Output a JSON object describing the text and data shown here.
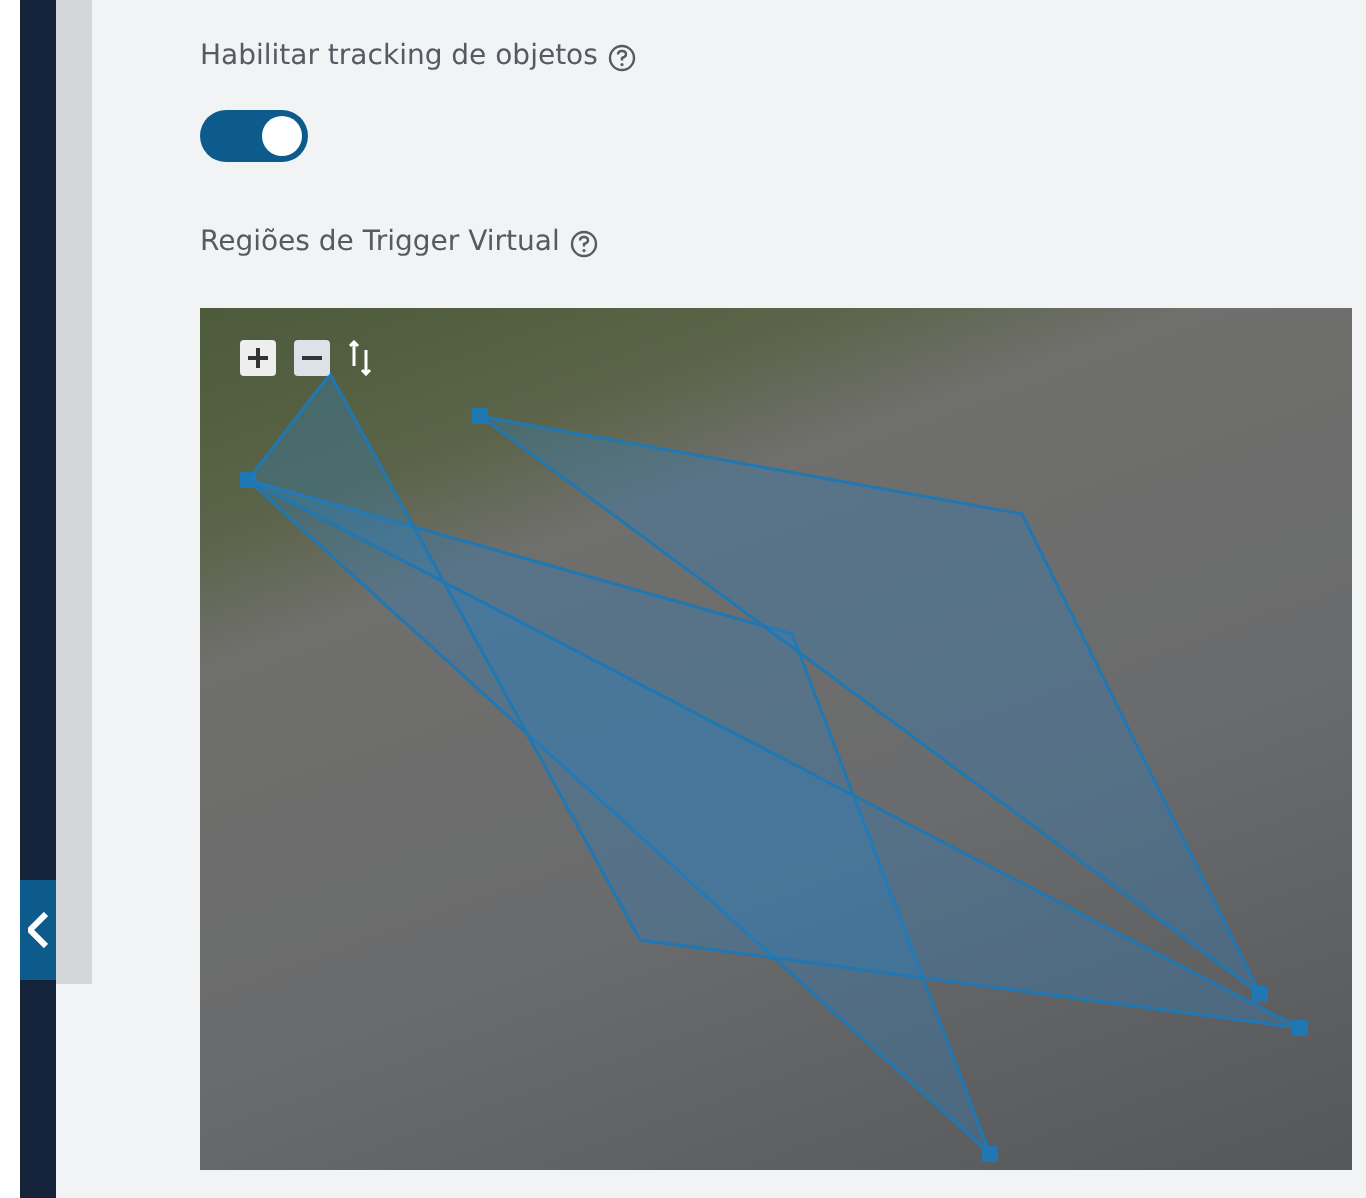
{
  "tracking": {
    "label": "Habilitar tracking de objetos",
    "on": true
  },
  "regions": {
    "label": "Regiões de Trigger Virtual"
  }
}
